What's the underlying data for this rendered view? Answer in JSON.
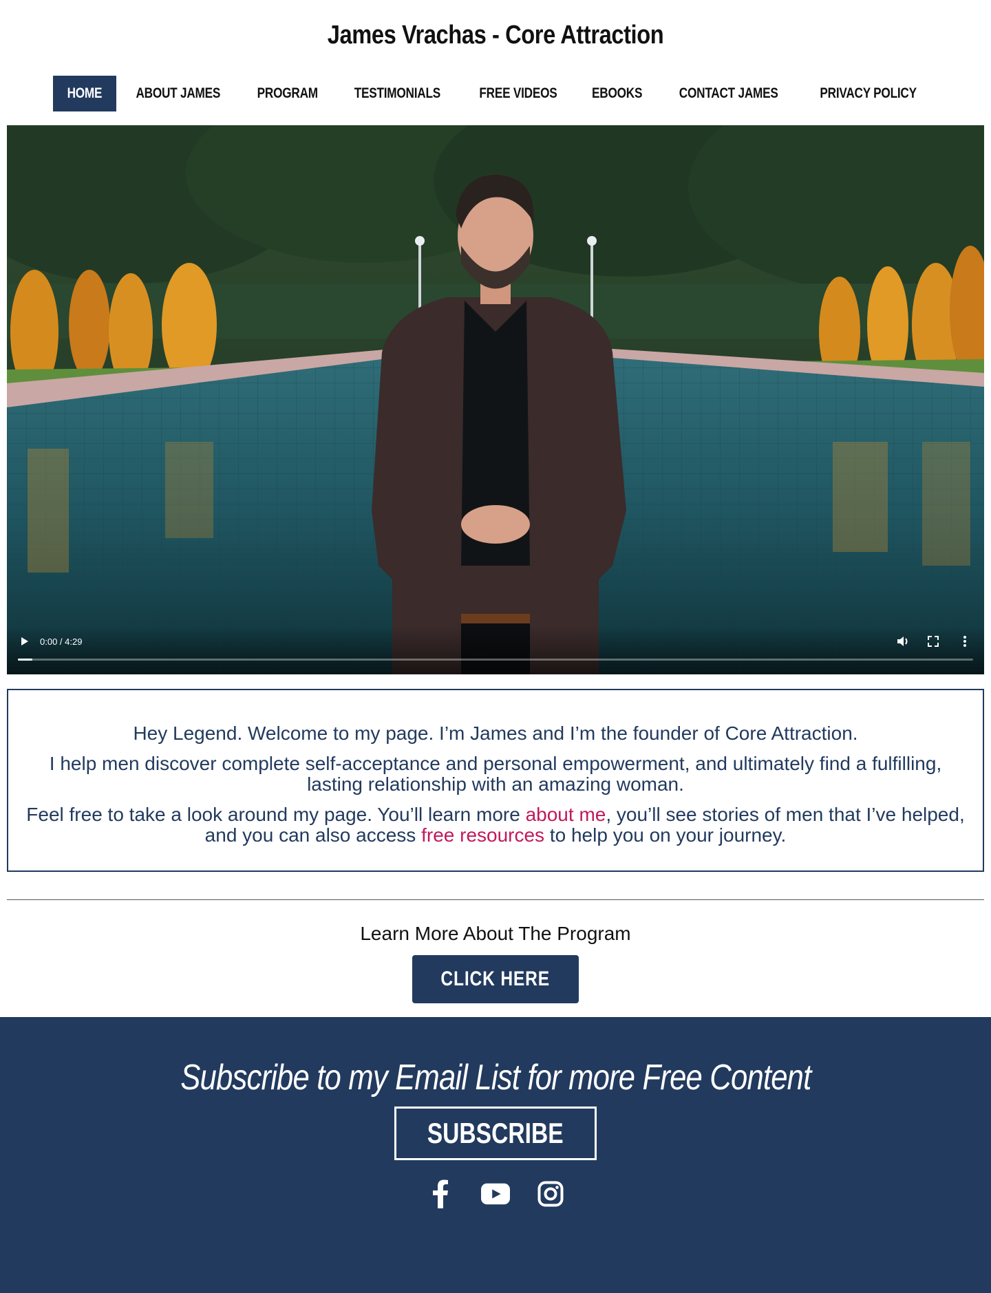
{
  "site": {
    "title": "James Vrachas - Core Attraction"
  },
  "nav": {
    "items": [
      {
        "label": "HOME",
        "active": true
      },
      {
        "label": "ABOUT JAMES"
      },
      {
        "label": "PROGRAM"
      },
      {
        "label": "TESTIMONIALS"
      },
      {
        "label": "FREE VIDEOS"
      },
      {
        "label": "EBOOKS"
      },
      {
        "label": "CONTACT JAMES"
      },
      {
        "label": "PRIVACY POLICY"
      }
    ]
  },
  "video": {
    "time": "0:00 / 4:29",
    "progress": 0.0,
    "icons": [
      "play-icon",
      "volume-icon",
      "fullscreen-icon",
      "more-options-icon"
    ]
  },
  "intro": {
    "line1": "Hey Legend. Welcome to my page. I’m James and I’m the founder of Core Attraction.",
    "line2": "I help men discover complete self-acceptance and personal empowerment, and ultimately find a fulfilling, lasting relationship with an amazing woman.",
    "line3_pre": "Feel free to take a look around my page. You’ll learn more ",
    "line3_link1": "about me",
    "line3_mid": ", you’ll see stories of men that I’ve helped, and you can also access ",
    "line3_link2": "free resources",
    "line3_post": " to help you on your journey."
  },
  "program": {
    "label": "Learn More About The Program",
    "button": "CLICK HERE"
  },
  "footer": {
    "heading": "Subscribe to my Email List for more Free Content",
    "subscribe_button": "SUBSCRIBE",
    "social": [
      "facebook-icon",
      "youtube-icon",
      "instagram-icon"
    ]
  },
  "colors": {
    "navy": "#223a5e",
    "link": "#c2185b"
  }
}
